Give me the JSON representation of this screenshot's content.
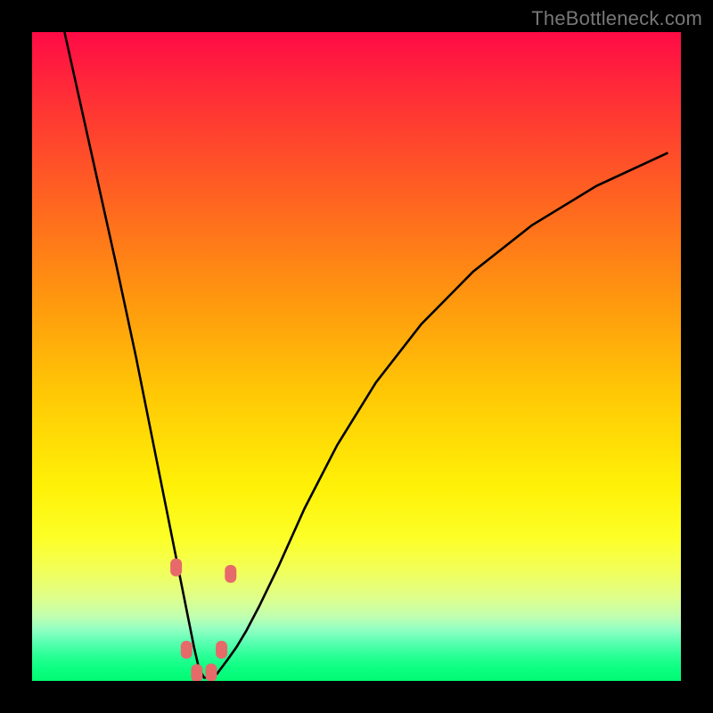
{
  "watermark": "TheBottleneck.com",
  "chart_data": {
    "type": "line",
    "title": "",
    "xlabel": "",
    "ylabel": "",
    "xlim": [
      0,
      100
    ],
    "ylim": [
      0,
      100
    ],
    "grid": false,
    "series": [
      {
        "name": "curve",
        "x": [
          5,
          7,
          9,
          11,
          13,
          14.5,
          16,
          17.5,
          19,
          20.5,
          22,
          23,
          24,
          25,
          25.7,
          26.5,
          27.5,
          28.5,
          30,
          31.5,
          33,
          35,
          38,
          42,
          47,
          53,
          60,
          68,
          77,
          87,
          98
        ],
        "y": [
          100,
          91,
          82,
          73,
          64,
          57,
          50,
          42.5,
          35,
          27.5,
          20,
          15,
          10,
          5,
          2,
          0.5,
          0.5,
          1.1,
          3.1,
          5.2,
          7.7,
          11.5,
          17.7,
          26.6,
          36.3,
          46.0,
          55.0,
          63.1,
          70.2,
          76.3,
          81.4
        ]
      },
      {
        "name": "markers",
        "type": "scatter",
        "x": [
          22.2,
          23.8,
          25.4,
          27.6,
          29.2,
          30.6
        ],
        "y": [
          17.5,
          4.8,
          1.2,
          1.3,
          4.8,
          16.5
        ]
      }
    ],
    "background_gradient": {
      "top": "#ff0a45",
      "middle": "#fff107",
      "bottom": "#01f973"
    }
  }
}
